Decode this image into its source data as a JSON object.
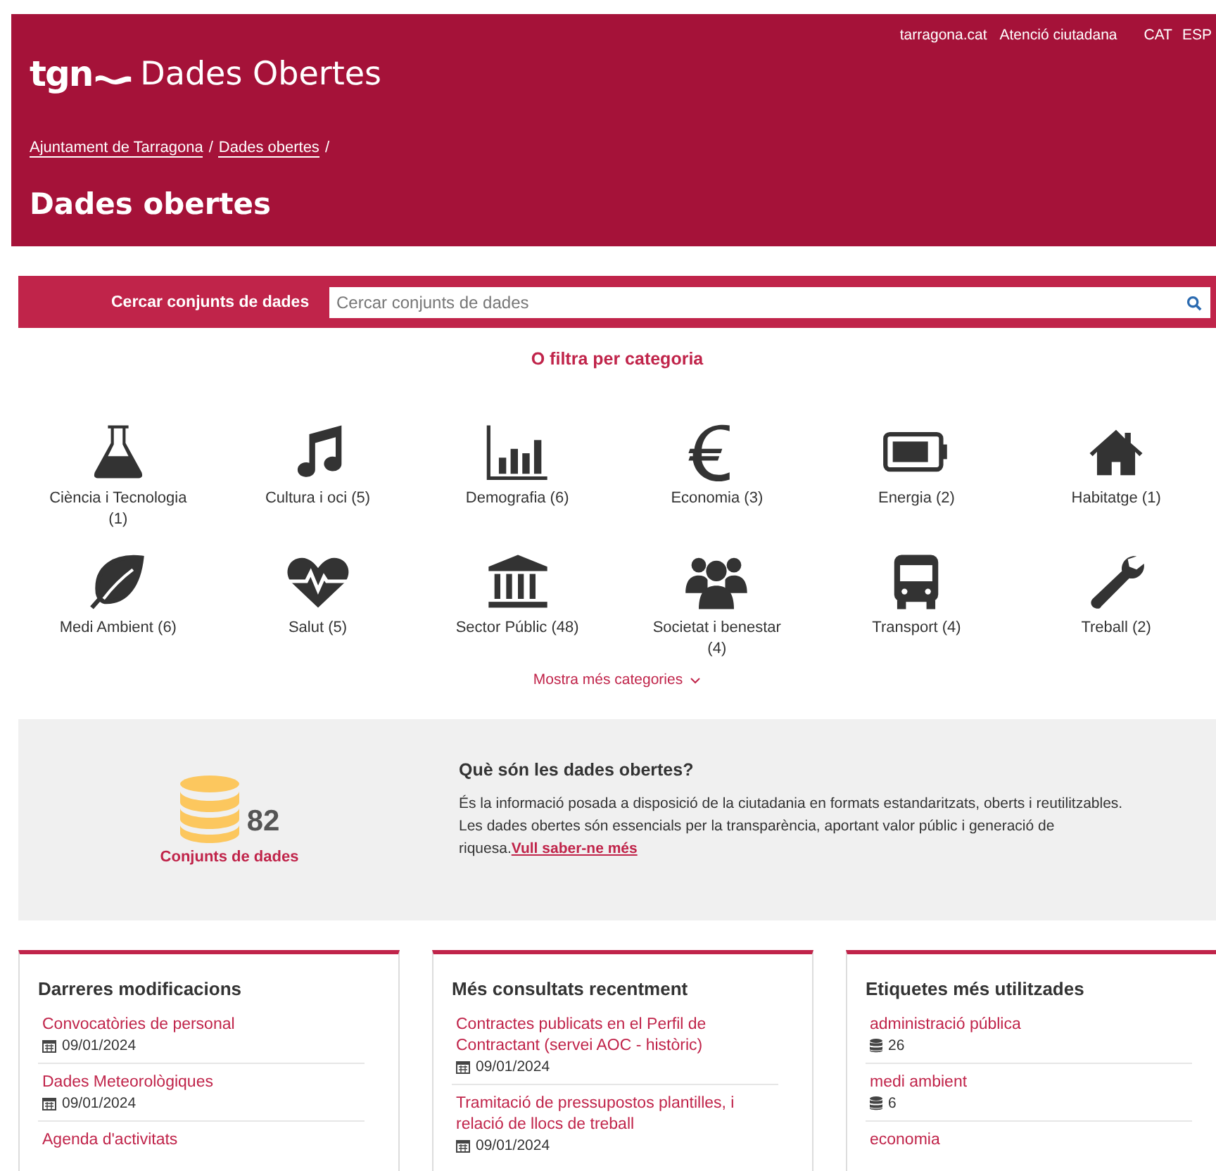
{
  "header": {
    "top_links": [
      "tarragona.cat",
      "Atenció ciutadana"
    ],
    "languages": [
      "CAT",
      "ESP"
    ],
    "logo": "tgn",
    "site_title": "Dades Obertes",
    "breadcrumb": [
      "Ajuntament de Tarragona",
      "Dades obertes"
    ],
    "breadcrumb_separator": "/",
    "page_title": "Dades obertes"
  },
  "search": {
    "label": "Cercar conjunts de dades",
    "placeholder": "Cercar conjunts de dades"
  },
  "categories": {
    "title": "O filtra per categoria",
    "more": "Mostra més categories",
    "items": [
      {
        "kind": "flask",
        "label": "Ciència i Tecnologia (1)"
      },
      {
        "kind": "music",
        "label": "Cultura i oci (5)"
      },
      {
        "kind": "chart",
        "label": "Demografia (6)"
      },
      {
        "kind": "euro",
        "label": "Economia (3)"
      },
      {
        "kind": "battery",
        "label": "Energia (2)"
      },
      {
        "kind": "house",
        "label": "Habitatge (1)"
      },
      {
        "kind": "leaf",
        "label": "Medi Ambient (6)"
      },
      {
        "kind": "heart",
        "label": "Salut (5)"
      },
      {
        "kind": "building",
        "label": "Sector Públic (48)"
      },
      {
        "kind": "people",
        "label": "Societat i benestar (4)"
      },
      {
        "kind": "bus",
        "label": "Transport (4)"
      },
      {
        "kind": "wrench",
        "label": "Treball (2)"
      }
    ]
  },
  "stats": {
    "count": "82",
    "label": "Conjunts de dades",
    "title": "Què són les dades obertes?",
    "lines": [
      "És la informació posada a disposició de la ciutadania en formats estandaritzats, oberts i reutilitzables.",
      "Les dades obertes són essencials per la transparència, aportant valor públic i generació de riquesa."
    ],
    "link": "Vull saber-ne més"
  },
  "cards": [
    {
      "title": "Darreres modificacions",
      "kind": "dates",
      "items": [
        {
          "title": "Convocatòries de personal",
          "meta": "09/01/2024"
        },
        {
          "title": "Dades Meteorològiques",
          "meta": "09/01/2024"
        },
        {
          "title": "Agenda d'activitats"
        }
      ]
    },
    {
      "title": "Més consultats recentment",
      "kind": "dates",
      "items": [
        {
          "title": "Contractes publicats en el Perfil de Contractant (servei AOC - històric)",
          "meta": "09/01/2024"
        },
        {
          "title": "Tramitació de pressupostos plantilles, i relació de llocs de treball",
          "meta": "09/01/2024"
        }
      ]
    },
    {
      "title": "Etiquetes més utilitzades",
      "kind": "counts",
      "items": [
        {
          "title": "administració pública",
          "meta": "26"
        },
        {
          "title": "medi ambient",
          "meta": "6"
        },
        {
          "title": "economia"
        }
      ]
    }
  ]
}
